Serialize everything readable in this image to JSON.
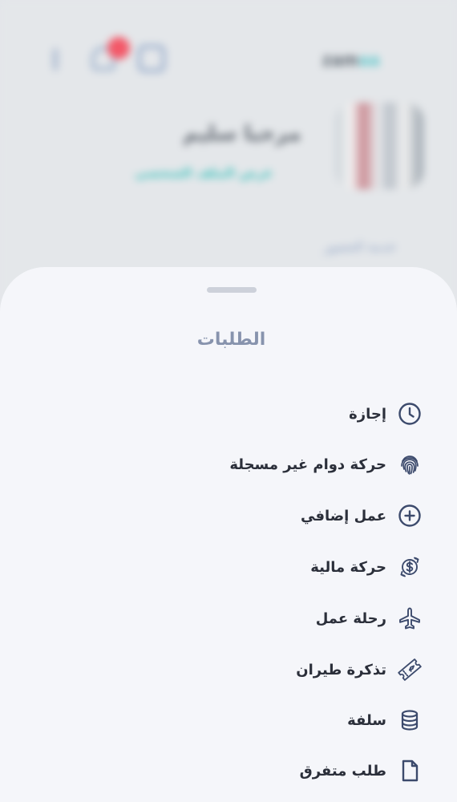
{
  "background": {
    "logo_main": "zam",
    "logo_accent": "aa",
    "greeting": "مرحبا سليم",
    "profile_link": "عرض الملف الشخصي",
    "section_label": "خدمة الحضور"
  },
  "sheet": {
    "title": "الطلبات",
    "items": [
      {
        "label": "إجازة",
        "icon": "clock-icon"
      },
      {
        "label": "حركة دوام غير مسجلة",
        "icon": "fingerprint-icon"
      },
      {
        "label": "عمل إضافي",
        "icon": "plus-circle-icon"
      },
      {
        "label": "حركة مالية",
        "icon": "money-exchange-icon"
      },
      {
        "label": "رحلة عمل",
        "icon": "airplane-icon"
      },
      {
        "label": "تذكرة طيران",
        "icon": "ticket-icon"
      },
      {
        "label": "سلفة",
        "icon": "database-icon"
      },
      {
        "label": "طلب متفرق",
        "icon": "document-icon"
      }
    ]
  },
  "colors": {
    "accent": "#3fc2bd",
    "badge": "#f35868",
    "sheet_bg": "#f5f6fa",
    "icon_stroke": "#3c4a6c"
  }
}
